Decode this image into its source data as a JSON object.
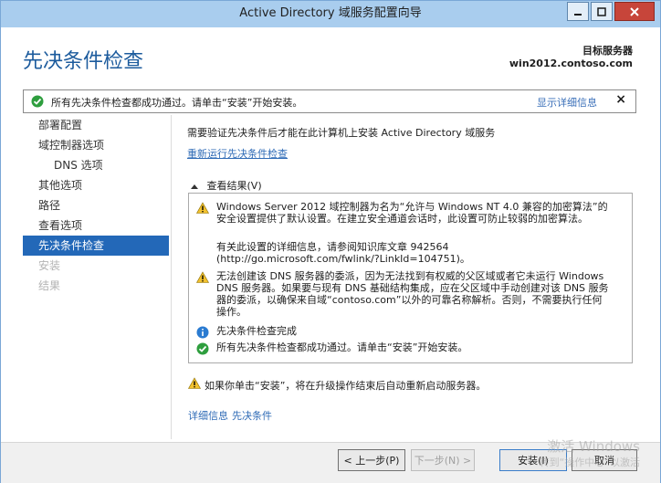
{
  "window": {
    "title": "Active Directory 域服务配置向导"
  },
  "header": {
    "page_title": "先决条件检查",
    "target_label": "目标服务器",
    "target_value": "win2012.contoso.com"
  },
  "notice": {
    "message": "所有先决条件检查都成功通过。请单击“安装”开始安装。",
    "details_link": "显示详细信息",
    "close": "×"
  },
  "sidebar": {
    "items": [
      {
        "label": "部署配置",
        "state": "normal"
      },
      {
        "label": "域控制器选项",
        "state": "normal"
      },
      {
        "label": "DNS 选项",
        "state": "sub"
      },
      {
        "label": "其他选项",
        "state": "normal"
      },
      {
        "label": "路径",
        "state": "normal"
      },
      {
        "label": "查看选项",
        "state": "normal"
      },
      {
        "label": "先决条件检查",
        "state": "active"
      },
      {
        "label": "安装",
        "state": "disabled"
      },
      {
        "label": "结果",
        "state": "disabled"
      }
    ]
  },
  "main": {
    "description": "需要验证先决条件后才能在此计算机上安装 Active Directory 域服务",
    "rerun_link": "重新运行先决条件检查",
    "results_label": "查看结果(V)",
    "results": [
      {
        "icon": "warning-icon",
        "text": "Windows Server 2012 域控制器为名为“允许与 Windows NT 4.0 兼容的加密算法”的安全设置提供了默认设置。在建立安全通道会话时，此设置可防止较弱的加密算法。"
      },
      {
        "icon": "none",
        "text": "有关此设置的详细信息，请参阅知识库文章 942564 (http://go.microsoft.com/fwlink/?LinkId=104751)。"
      },
      {
        "icon": "warning-icon",
        "text": "无法创建该 DNS 服务器的委派，因为无法找到有权威的父区域或者它未运行 Windows DNS 服务器。如果要与现有 DNS 基础结构集成，应在父区域中手动创建对该 DNS 服务器的委派，以确保来自域“contoso.com”以外的可靠名称解析。否则，不需要执行任何操作。"
      },
      {
        "icon": "info-icon",
        "text": "先决条件检查完成"
      },
      {
        "icon": "check-icon",
        "text": "所有先决条件检查都成功通过。请单击“安装”开始安装。"
      }
    ],
    "restart_warning": "如果你单击“安装”，将在升级操作结束后自动重新启动服务器。",
    "more_link_1": "详细信息",
    "more_link_2": "先决条件"
  },
  "buttons": {
    "prev": "< 上一步(P)",
    "next": "下一步(N) >",
    "install": "安装(I)",
    "cancel": "取消"
  },
  "watermark": {
    "line1": "激活 Windows",
    "line2": "转到“操作中心”以激活"
  },
  "colors": {
    "accent": "#2368b8",
    "title_bar": "#a9cdee",
    "link": "#2f6bb6",
    "page_title": "#1c5b9d"
  }
}
